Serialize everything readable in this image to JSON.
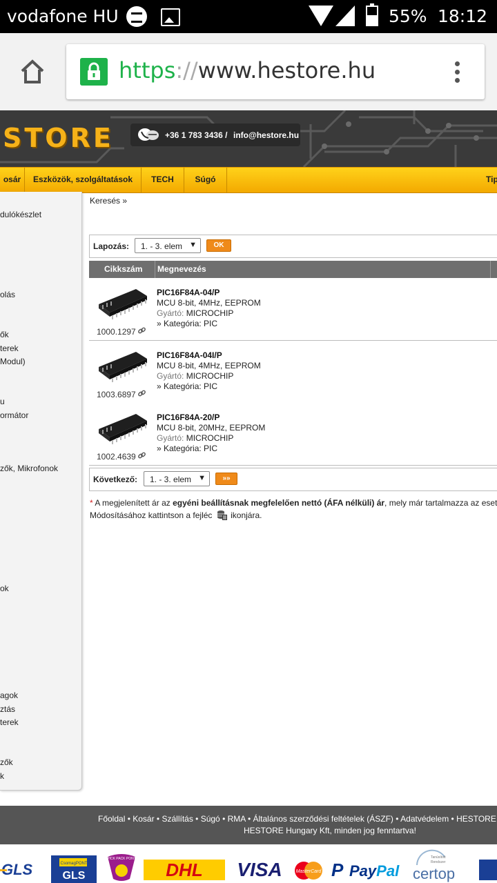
{
  "status_bar": {
    "carrier": "vodafone HU",
    "battery_pct": "55%",
    "time": "18:12"
  },
  "browser": {
    "url_scheme": "https",
    "url_sep": "://",
    "url_host": "www.hestore.hu"
  },
  "header": {
    "logo": "STORE",
    "phone": "+36 1 783 3436 /",
    "email": "info@hestore.hu"
  },
  "nav": {
    "items": [
      "osár",
      "Eszközök, szolgáltatások",
      "TECH",
      "Súgó",
      "Tip"
    ]
  },
  "sidebar": {
    "items": [
      "dulókészlet",
      "olás",
      "ők",
      "terek",
      " Modul)",
      "u",
      "ormátor",
      "zők, Mikrofonok",
      "ok",
      "agok",
      "ztás",
      "terek",
      "zők",
      "k"
    ]
  },
  "breadcrumb": "Keresés »",
  "pager_top": {
    "label": "Lapozás:",
    "select": "1. - 3. elem",
    "ok": "OK"
  },
  "table": {
    "headers": [
      "Cikkszám",
      "Megnevezés"
    ],
    "rows": [
      {
        "code": "1000.1297",
        "name": "PIC16F84A-04/P",
        "desc": "MCU 8-bit, 4MHz, EEPROM",
        "maker_label": "Gyártó:",
        "maker": "MICROCHIP",
        "category": "» Kategória: PIC"
      },
      {
        "code": "1003.6897",
        "name": "PIC16F84A-04I/P",
        "desc": "MCU 8-bit, 4MHz, EEPROM",
        "maker_label": "Gyártó:",
        "maker": "MICROCHIP",
        "category": "» Kategória: PIC"
      },
      {
        "code": "1002.4639",
        "name": "PIC16F84A-20/P",
        "desc": "MCU 8-bit, 20MHz, EEPROM",
        "maker_label": "Gyártó:",
        "maker": "MICROCHIP",
        "category": "» Kategória: PIC"
      }
    ]
  },
  "pager_bottom": {
    "label": "Következő:",
    "select": "1. - 3. elem",
    "go": "»»"
  },
  "note": {
    "star": "*",
    "t1": "A megjelenített ár az ",
    "b1": "egyéni beállításnak megfelelően nettó (ÁFA nélküli) ár",
    "t2": ", mely már tartalmazza az esetlege",
    "line2a": "Módosításához kattintson a fejléc",
    "line2b": "ikonjára."
  },
  "footer": {
    "links": [
      "Főoldal",
      "Kosár",
      "Szállítás",
      "Súgó",
      "RMA",
      "Általános szerződési feltételek (ÁSZF)",
      "Adatvédelem",
      "HESTORE API"
    ],
    "copyright": "HESTORE Hungary Kft, minden jog fenntartva!"
  },
  "partner_logos": [
    "GLS",
    "CsomagPONT GLS",
    "PICK PACK PONT",
    "DHL",
    "VISA",
    "MasterCard",
    "PayPal",
    "certop",
    ""
  ],
  "colors": {
    "accent": "#f6b219",
    "nav": "#f3a900",
    "green": "#1eb24a",
    "cart": "#d42020",
    "orange_btn": "#ef8a1a"
  }
}
